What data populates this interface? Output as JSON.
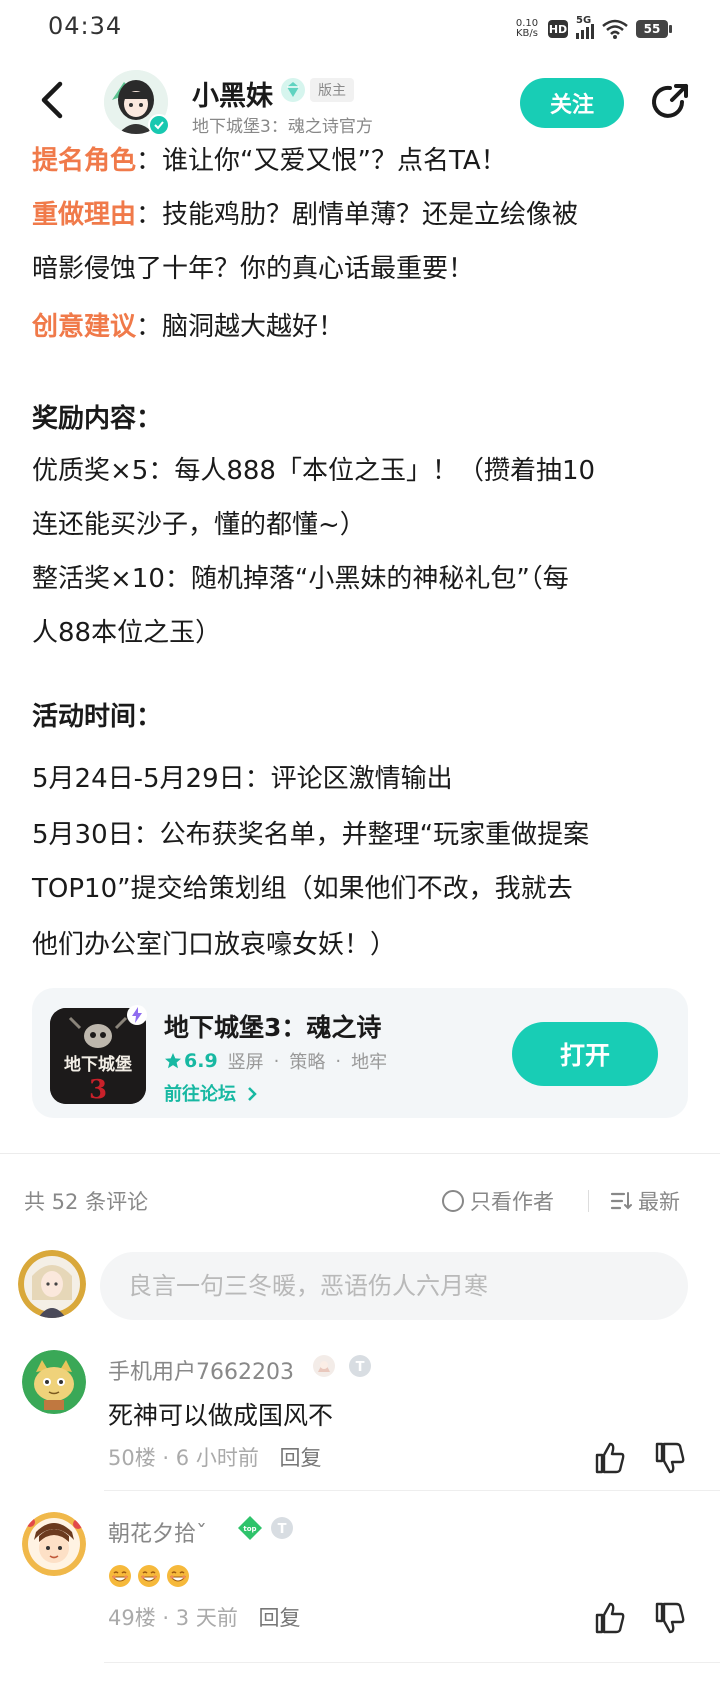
{
  "status_bar": {
    "time": "04:34",
    "net_speed_value": "0.10",
    "net_speed_unit": "KB/s",
    "hd": "HD",
    "network": "5G",
    "battery": "55"
  },
  "header": {
    "author_name": "小黑妹",
    "author_role": "版主",
    "author_subtitle": "地下城堡3：魂之诗官方",
    "follow_label": "关注"
  },
  "article": {
    "role_label": "提名角色",
    "role_text": "：谁让你“又爱又恨”？点名TA！",
    "reason_label": "重做理由",
    "reason_text_1": "：技能鸡肋？剧情单薄？还是立绘像被",
    "reason_text_2": "暗影侵蚀了十年？你的真心话最重要！",
    "idea_label": "创意建议",
    "idea_text": "：脑洞越大越好！",
    "reward_title": "奖励内容：",
    "reward_1a": "优质奖×5：每人888「本位之玉」！（攒着抽10",
    "reward_1b": "连还能买沙子，懂的都懂~）",
    "reward_2a": "整活奖×10：随机掉落“小黑妹的神秘礼包”（每",
    "reward_2b": "人88本位之玉）",
    "time_title": "活动时间：",
    "time_1": "5月24日-5月29日：评论区激情输出",
    "time_2a": "5月30日：公布获奖名单，并整理“玩家重做提案",
    "time_2b": "TOP10”提交给策划组（如果他们不改，我就去",
    "time_2c": "他们办公室门口放哀嚎女妖！）"
  },
  "game_card": {
    "name": "地下城堡3：魂之诗",
    "rating": "6.9",
    "tags": [
      "竖屏",
      "策略",
      "地牢"
    ],
    "forum_link": "前往论坛",
    "open_label": "打开",
    "icon_text": "地下城堡",
    "icon_number": "3"
  },
  "comments_bar": {
    "count_text": "共 52 条评论",
    "author_only": "只看作者",
    "sort": "最新"
  },
  "comment_input": {
    "placeholder": "良言一句三冬暖，恶语伤人六月寒"
  },
  "comments": [
    {
      "user": "手机用户7662203",
      "text": "死神可以做成国风不",
      "floor": "50楼",
      "time": "6 小时前",
      "reply": "回复"
    },
    {
      "user": "朝花夕拾ˇ",
      "text": "",
      "emoji_count": 3,
      "floor": "49楼",
      "time": "3 天前",
      "reply": "回复"
    }
  ],
  "colors": {
    "accent": "#18cdb5",
    "highlight": "#f07a4a"
  },
  "icons": [
    "back-icon",
    "share-icon",
    "verified-icon",
    "star-icon",
    "chevron-right-icon",
    "sort-icon",
    "thumbs-up-icon",
    "thumbs-down-icon",
    "grin-emoji-icon"
  ]
}
